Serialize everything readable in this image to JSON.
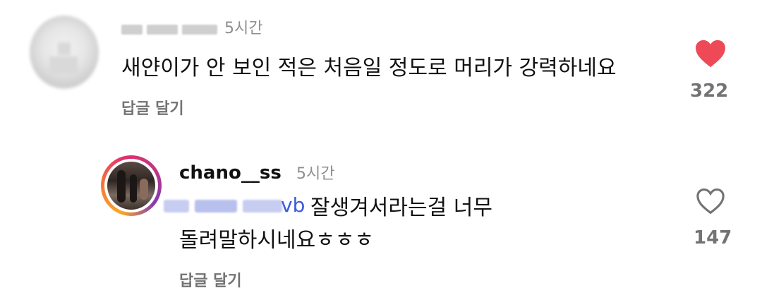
{
  "comments": [
    {
      "username": "",
      "time": "5시간",
      "text": "새얀이가 안 보인 적은 처음일 정도로 머리가 강력하네요",
      "reply_label": "답글 달기",
      "likes": "322",
      "liked": true,
      "avatar_icon": "blurred-avatar-icon"
    },
    {
      "username": "chano__ss",
      "time": "5시간",
      "mention_visible_tail": "vb",
      "text_line1": "잘생겨서라는걸 너무",
      "text_line2": "돌려말하시네요ㅎㅎㅎ",
      "reply_label": "답글 달기",
      "likes": "147",
      "liked": false,
      "avatar_icon": "profile-photo-avatar"
    }
  ],
  "colors": {
    "heart_liked": "#ed4956",
    "secondary_text": "#737373",
    "mention": "#3b5bdb"
  }
}
